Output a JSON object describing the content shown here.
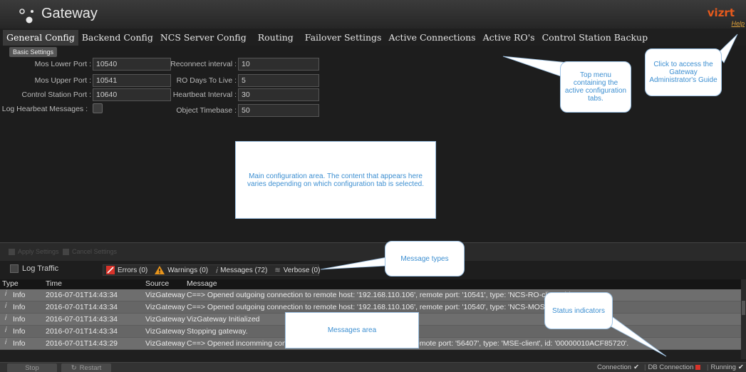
{
  "app": {
    "title": "Gateway",
    "brand": "vizrt",
    "help_label": "Help"
  },
  "tabs": [
    {
      "label": "General Config",
      "active": true
    },
    {
      "label": "Backend Config"
    },
    {
      "label": "NCS Server Config"
    },
    {
      "label": "Routing"
    },
    {
      "label": "Failover Settings"
    },
    {
      "label": "Active Connections"
    },
    {
      "label": "Active RO's"
    },
    {
      "label": "Control Station Backup"
    }
  ],
  "basic_settings": {
    "section_label": "Basic Settings",
    "mos_lower_port": {
      "label": "Mos Lower Port :",
      "value": "10540"
    },
    "mos_upper_port": {
      "label": "Mos Upper Port :",
      "value": "10541"
    },
    "control_station_port": {
      "label": "Control Station Port :",
      "value": "10640"
    },
    "log_heartbeat": {
      "label": "Log Hearbeat Messages :"
    },
    "reconnect_interval": {
      "label": "Reconnect interval :",
      "value": "10"
    },
    "ro_days_to_live": {
      "label": "RO Days To Live :",
      "value": "5"
    },
    "heartbeat_interval": {
      "label": "Heartbeat Interval :",
      "value": "30"
    },
    "object_timebase": {
      "label": "Object Timebase :",
      "value": "50"
    }
  },
  "callouts": {
    "help": "Click to access the Gateway Administrator's Guide",
    "top_menu": "Top menu containing the active configuration tabs.",
    "main_area": "Main configuration area. The content that appears here varies depending on which configuration tab is selected.",
    "message_types": "Message types",
    "status_indicators": "Status indicators",
    "messages_area": "Messages area"
  },
  "actions": {
    "apply": "Apply Settings",
    "cancel": "Cancel Settings"
  },
  "filters": {
    "log_traffic": "Log Traffic",
    "errors": "Errors (0)",
    "warnings": "Warnings (0)",
    "messages": "Messages (72)",
    "verbose": "Verbose (0)"
  },
  "log": {
    "columns": {
      "type": "Type",
      "time": "Time",
      "source": "Source",
      "message": "Message"
    },
    "rows": [
      {
        "type": "Info",
        "time": "2016-07-01T14:43:34",
        "source": "VizGateway",
        "message": "C==> Opened outgoing connection to remote host: '192.168.110.106', remote port: '10541', type: 'NCS-RO-client', id:"
      },
      {
        "type": "Info",
        "time": "2016-07-01T14:43:34",
        "source": "VizGateway",
        "message": "C==> Opened outgoing connection to remote host: '192.168.110.106', remote port: '10540', type: 'NCS-MOS-client', id:"
      },
      {
        "type": "Info",
        "time": "2016-07-01T14:43:34",
        "source": "VizGateway",
        "message": "VizGateway Initialized"
      },
      {
        "type": "Info",
        "time": "2016-07-01T14:43:34",
        "source": "VizGateway",
        "message": "Stopping gateway."
      },
      {
        "type": "Info",
        "time": "2016-07-01T14:43:29",
        "source": "VizGateway",
        "message": "C==> Opened incomming conn"
      }
    ],
    "row5_tail": "emote port: '56407', type: 'MSE-client', id: '00000010ACF85720'."
  },
  "status_bar": {
    "stop": "Stop",
    "restart": "Restart",
    "connection": "Connection",
    "db_connection": "DB Connection",
    "running": "Running"
  },
  "colors": {
    "accent": "#e85a1c",
    "callout_text": "#3d8fd1",
    "error": "#d8332a",
    "warning": "#e8951c"
  }
}
